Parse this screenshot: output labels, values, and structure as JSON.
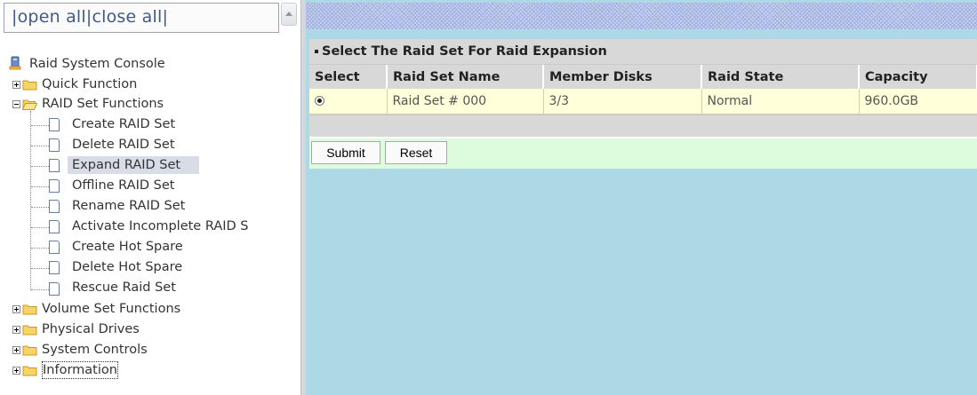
{
  "top_links": {
    "open_all": "open all",
    "close_all": "close all",
    "sep": "|"
  },
  "tree": {
    "root": "Raid System Console",
    "items": [
      {
        "label": "Quick Function",
        "expanded": false
      },
      {
        "label": "RAID Set Functions",
        "expanded": true,
        "children": [
          "Create RAID Set",
          "Delete RAID Set",
          "Expand RAID Set",
          "Offline RAID Set",
          "Rename RAID Set",
          "Activate Incomplete RAID S",
          "Create Hot Spare",
          "Delete Hot Spare",
          "Rescue Raid Set"
        ]
      },
      {
        "label": "Volume Set Functions",
        "expanded": false
      },
      {
        "label": "Physical Drives",
        "expanded": false
      },
      {
        "label": "System Controls",
        "expanded": false
      },
      {
        "label": "Information",
        "expanded": false
      }
    ],
    "selected": "Expand RAID Set"
  },
  "panel": {
    "caption": "Select The Raid Set For Raid Expansion",
    "columns": [
      "Select",
      "Raid Set Name",
      "Member Disks",
      "Raid State",
      "Capacity"
    ],
    "rows": [
      {
        "select": true,
        "name": "Raid Set # 000",
        "member_disks": "3/3",
        "state": "Normal",
        "capacity": "960.0GB"
      }
    ],
    "submit_label": "Submit",
    "reset_label": "Reset"
  },
  "colors": {
    "right_bg": "#add8e6",
    "row_bg": "#ffffd9",
    "button_row_bg": "#ddfbdd",
    "header_bg": "#d8d8d8"
  }
}
